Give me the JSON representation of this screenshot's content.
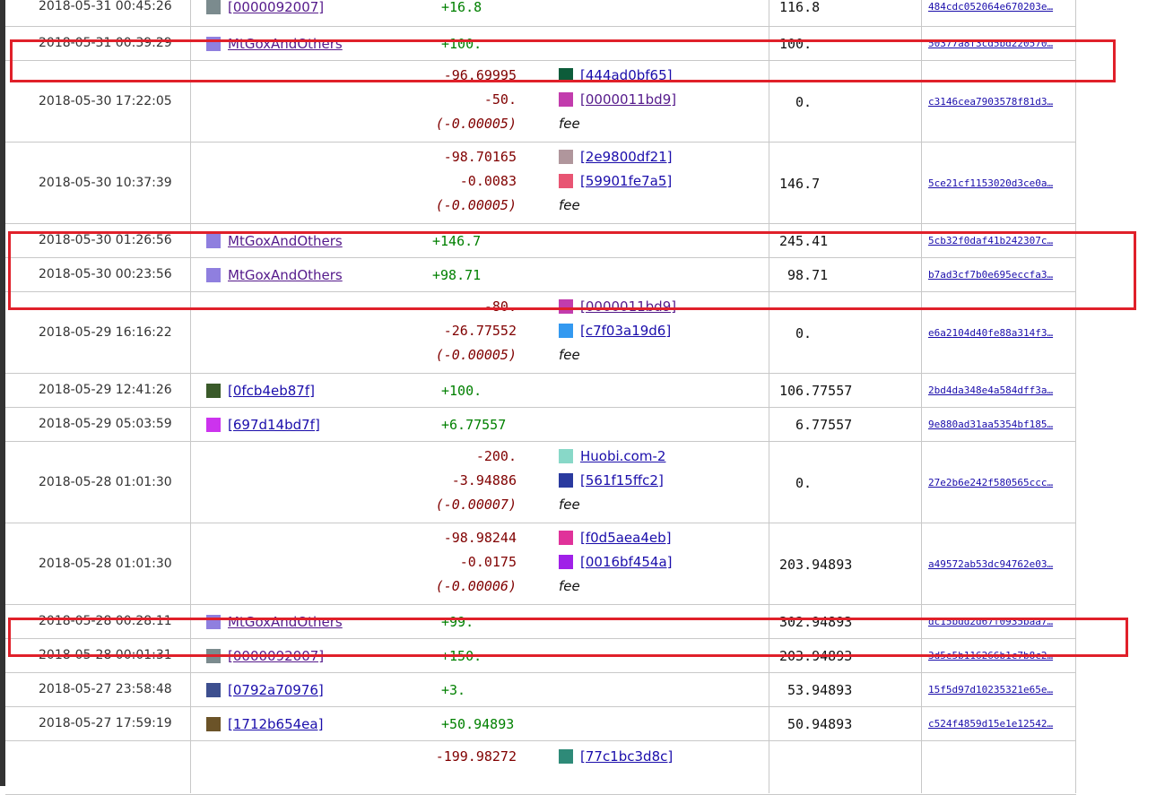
{
  "colors": {
    "highlight": "#e0202a",
    "positive": "#008000",
    "negative": "#800000",
    "link_visited": "#551a8b",
    "link": "#1a0dab"
  },
  "rows": [
    {
      "date": "2018-05-31 00:45:26",
      "wallet": {
        "name": "[0000092007]",
        "color": "#7b8b8e"
      },
      "amount": "+16.8",
      "balance": "116.8",
      "txid": "484cdc052064e670203e…"
    },
    {
      "date": "2018-05-31 00:39:29",
      "wallet": {
        "name": "MtGoxAndOthers",
        "color": "#8f7fdf"
      },
      "amount": "+100.",
      "balance": "100.",
      "txid": "50377a8f3cd5bd220570…"
    },
    {
      "date": "2018-05-30 17:22:05",
      "outputs": [
        {
          "amount": "-96.69995",
          "name": "[444ad0bf65]",
          "color": "#0d5c3a"
        },
        {
          "amount": "-50.",
          "name": "[0000011bd9]",
          "color": "#c23cad"
        }
      ],
      "fee": "(-0.00005)",
      "fee_label": "fee",
      "balance": "0.",
      "txid": "c3146cea7903578f81d3…"
    },
    {
      "date": "2018-05-30 10:37:39",
      "outputs": [
        {
          "amount": "-98.70165",
          "name": "[2e9800df21]",
          "color": "#b0969c"
        },
        {
          "amount": "-0.0083",
          "name": "[59901fe7a5]",
          "color": "#e85573"
        }
      ],
      "fee": "(-0.00005)",
      "fee_label": "fee",
      "balance": "146.7",
      "txid": "5ce21cf1153020d3ce0a…"
    },
    {
      "date": "2018-05-30 01:26:56",
      "wallet": {
        "name": "MtGoxAndOthers",
        "color": "#8f7fdf"
      },
      "amount": "+146.7",
      "balance": "245.41",
      "txid": "5cb32f0daf41b242307c…"
    },
    {
      "date": "2018-05-30 00:23:56",
      "wallet": {
        "name": "MtGoxAndOthers",
        "color": "#8f7fdf"
      },
      "amount": "+98.71",
      "balance": "98.71",
      "txid": "b7ad3cf7b0e695eccfa3…"
    },
    {
      "date": "2018-05-29 16:16:22",
      "outputs": [
        {
          "amount": "-80.",
          "name": "[0000011bd9]",
          "color": "#c23cad"
        },
        {
          "amount": "-26.77552",
          "name": "[c7f03a19d6]",
          "color": "#3399f0"
        }
      ],
      "fee": "(-0.00005)",
      "fee_label": "fee",
      "balance": "0.",
      "txid": "e6a2104d40fe88a314f3…"
    },
    {
      "date": "2018-05-29 12:41:26",
      "wallet": {
        "name": "[0fcb4eb87f]",
        "color": "#3a5a2a"
      },
      "amount": "+100.",
      "balance": "106.77557",
      "txid": "2bd4da348e4a584dff3a…"
    },
    {
      "date": "2018-05-29 05:03:59",
      "wallet": {
        "name": "[697d14bd7f]",
        "color": "#cc33ee"
      },
      "amount": "+6.77557",
      "balance": "6.77557",
      "txid": "9e880ad31aa5354bf185…"
    },
    {
      "date": "2018-05-28 01:01:30",
      "outputs": [
        {
          "amount": "-200.",
          "name": "Huobi.com-2",
          "color": "#88d8c8"
        },
        {
          "amount": "-3.94886",
          "name": "[561f15ffc2]",
          "color": "#2a3a9f"
        }
      ],
      "fee": "(-0.00007)",
      "fee_label": "fee",
      "balance": "0.",
      "txid": "27e2b6e242f580565ccc…"
    },
    {
      "date": "2018-05-28 01:01:30",
      "outputs": [
        {
          "amount": "-98.98244",
          "name": "[f0d5aea4eb]",
          "color": "#e0329a"
        },
        {
          "amount": "-0.0175",
          "name": "[0016bf454a]",
          "color": "#a020e8"
        }
      ],
      "fee": "(-0.00006)",
      "fee_label": "fee",
      "balance": "203.94893",
      "txid": "a49572ab53dc94762e03…"
    },
    {
      "date": "2018-05-28 00:28:11",
      "wallet": {
        "name": "MtGoxAndOthers",
        "color": "#8f7fdf"
      },
      "amount": "+99.",
      "balance": "302.94893",
      "txid": "dc15bdd2d67f0935baa7…"
    },
    {
      "date": "2018-05-28 00:01:31",
      "wallet": {
        "name": "[0000092007]",
        "color": "#7b8b8e"
      },
      "amount": "+150.",
      "balance": "203.94893",
      "txid": "3d5e5b116266b1c7b8c2…"
    },
    {
      "date": "2018-05-27 23:58:48",
      "wallet": {
        "name": "[0792a70976]",
        "color": "#3d4f8f"
      },
      "amount": "+3.",
      "balance": "53.94893",
      "txid": "15f5d97d10235321e65e…"
    },
    {
      "date": "2018-05-27 17:59:19",
      "wallet": {
        "name": "[1712b654ea]",
        "color": "#6b5328"
      },
      "amount": "+50.94893",
      "balance": "50.94893",
      "txid": "c524f4859d15e1e12542…"
    },
    {
      "partial": true,
      "outputs": [
        {
          "amount": "-199.98272",
          "name": "[77c1bc3d8c]",
          "color": "#2e8a78"
        }
      ]
    }
  ]
}
